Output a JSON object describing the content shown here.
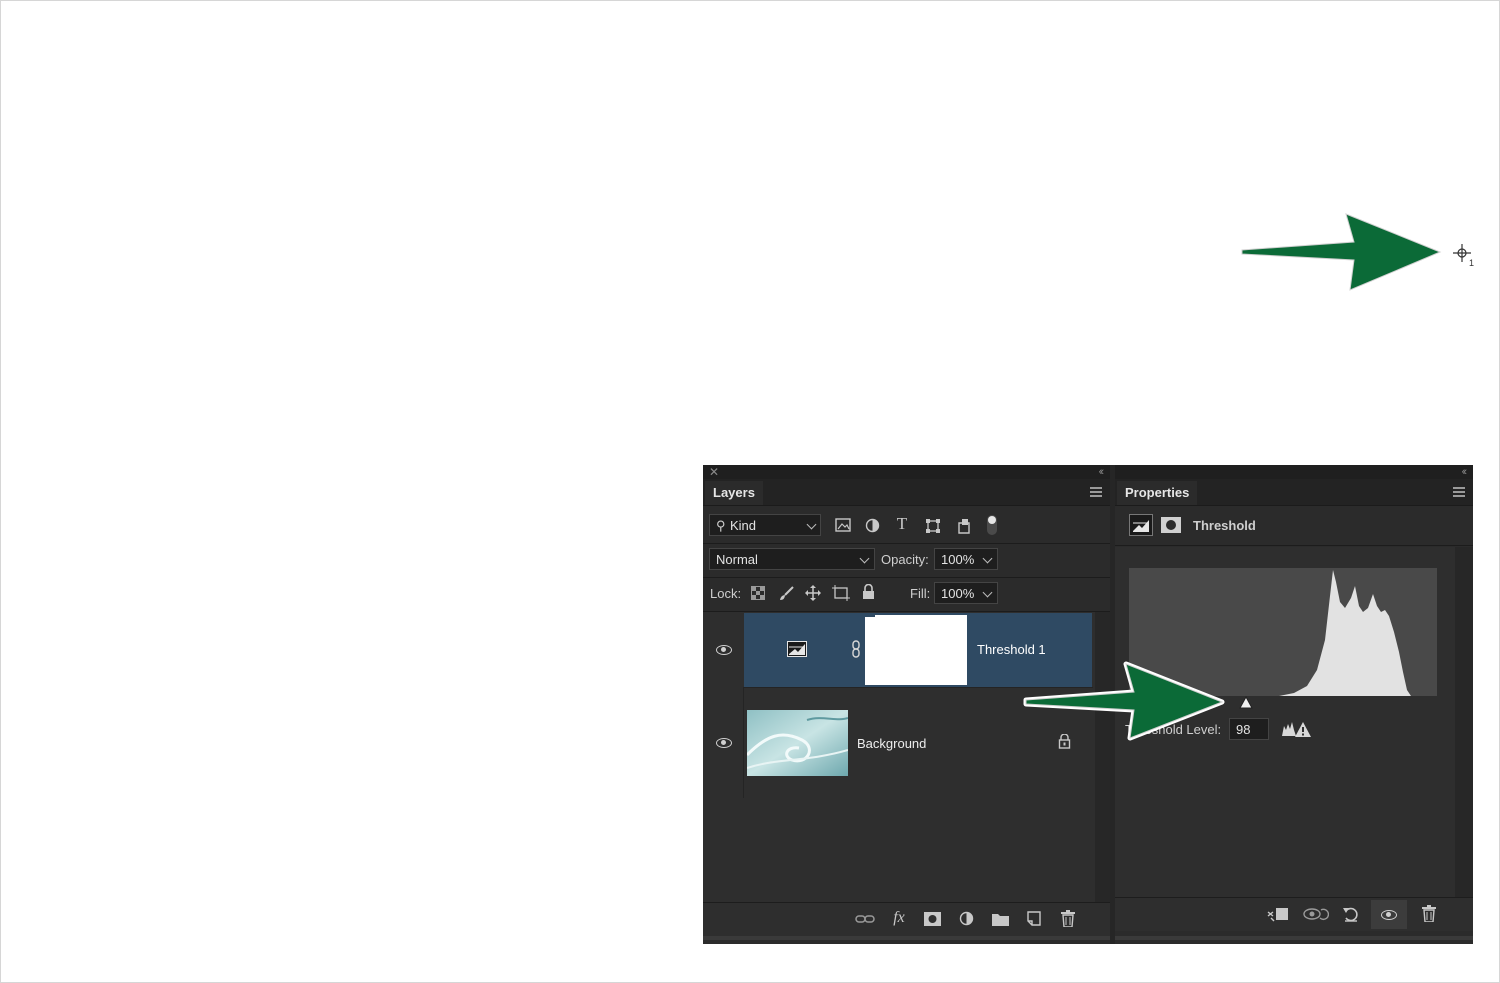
{
  "layers_panel": {
    "tab_label": "Layers",
    "filter": {
      "kind_label": "Kind"
    },
    "blend_mode": "Normal",
    "opacity_label": "Opacity:",
    "opacity_value": "100%",
    "lock_label": "Lock:",
    "fill_label": "Fill:",
    "fill_value": "100%",
    "layers": [
      {
        "name": "Threshold 1",
        "selected": true,
        "visible": true
      },
      {
        "name": "Background",
        "selected": false,
        "visible": true,
        "locked": true
      }
    ],
    "bottom_icons": [
      "link-icon",
      "fx-icon",
      "mask-icon",
      "adjustment-icon",
      "folder-icon",
      "new-layer-icon",
      "trash-icon"
    ]
  },
  "properties_panel": {
    "tab_label": "Properties",
    "adjustment_title": "Threshold",
    "threshold_level_label": "Threshold Level:",
    "threshold_level_value": "98",
    "bottom_icons": [
      "clip-icon",
      "view-previous-icon",
      "reset-icon",
      "visibility-icon",
      "trash-icon"
    ]
  },
  "sampler": {
    "number": "1"
  },
  "colors": {
    "panel_bg": "#2b2b2b",
    "selected_layer": "#2f4a63",
    "arrow_green": "#0b6a37",
    "histogram_fill": "#e2e2e2"
  }
}
